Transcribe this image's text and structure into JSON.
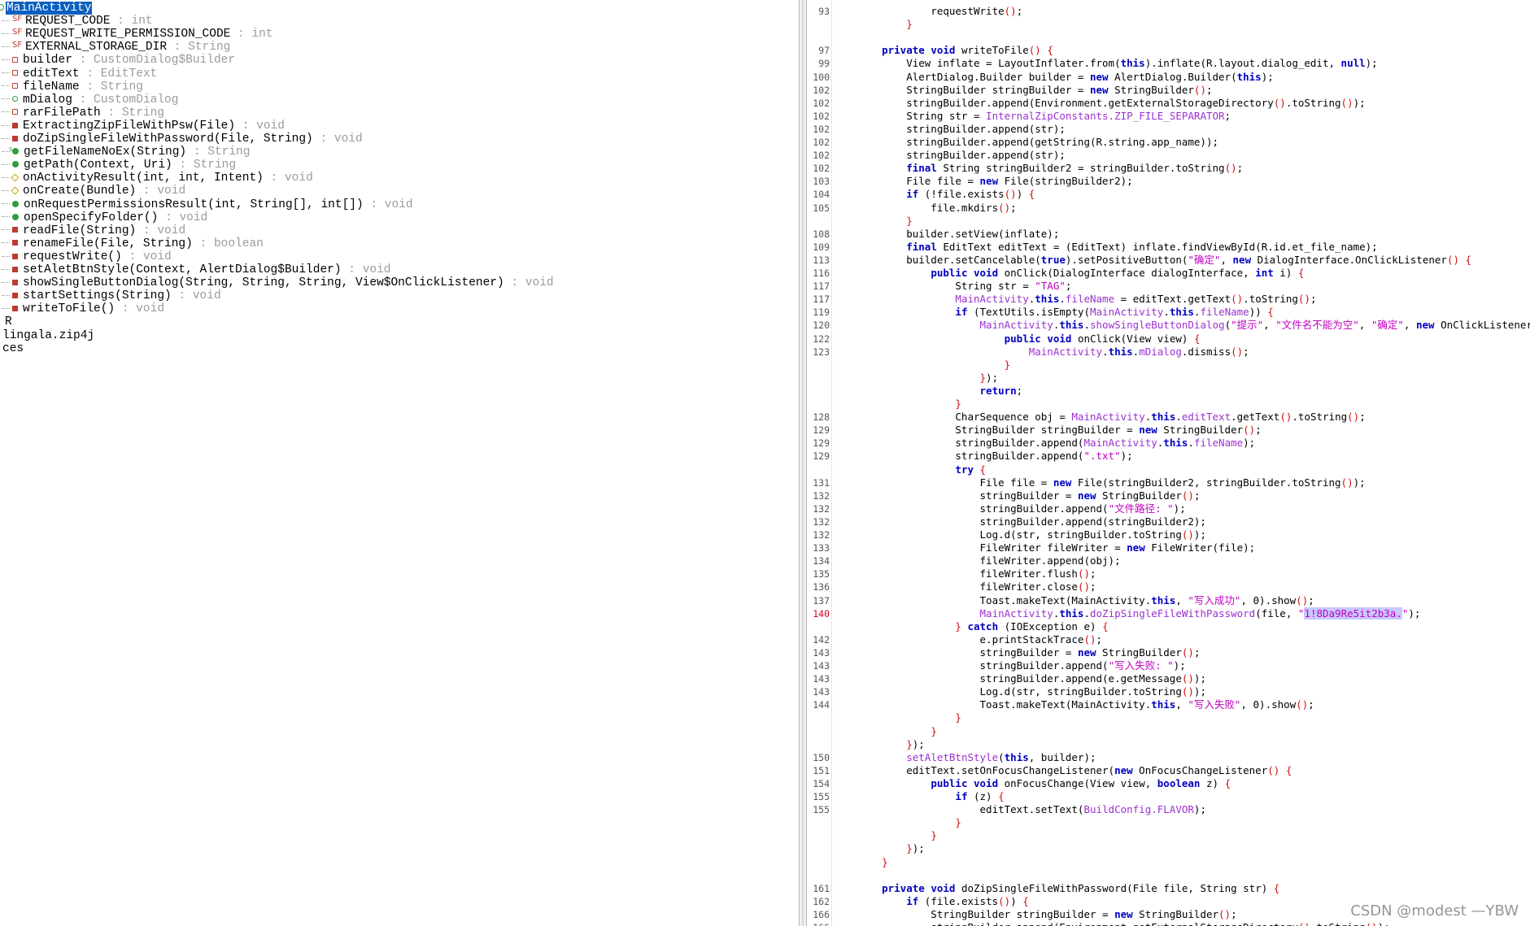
{
  "outline": {
    "root": "MainActivity",
    "members": [
      {
        "icon": "field-static",
        "name": "REQUEST_CODE",
        "type": "int"
      },
      {
        "icon": "field-static",
        "name": "REQUEST_WRITE_PERMISSION_CODE",
        "type": "int"
      },
      {
        "icon": "field-static",
        "name": "EXTERNAL_STORAGE_DIR",
        "type": "String"
      },
      {
        "icon": "field-private",
        "name": "builder",
        "type": "CustomDialog$Builder"
      },
      {
        "icon": "field-private",
        "name": "editText",
        "type": "EditText"
      },
      {
        "icon": "field-private",
        "name": "fileName",
        "type": "String"
      },
      {
        "icon": "method-public-hollow",
        "name": "mDialog",
        "type": "CustomDialog"
      },
      {
        "icon": "field-private",
        "name": "rarFilePath",
        "type": "String"
      },
      {
        "icon": "method-private",
        "name": "ExtractingZipFileWithPsw(File)",
        "type": "void"
      },
      {
        "icon": "method-private",
        "name": "doZipSingleFileWithPassword(File, String)",
        "type": "void"
      },
      {
        "icon": "method-static",
        "name": "getFileNameNoEx(String)",
        "type": "String"
      },
      {
        "icon": "method-public",
        "name": "getPath(Context, Uri)",
        "type": "String"
      },
      {
        "icon": "method-protected",
        "name": "onActivityResult(int, int, Intent)",
        "type": "void"
      },
      {
        "icon": "method-protected",
        "name": "onCreate(Bundle)",
        "type": "void"
      },
      {
        "icon": "method-public",
        "name": "onRequestPermissionsResult(int, String[], int[])",
        "type": "void"
      },
      {
        "icon": "method-public",
        "name": "openSpecifyFolder()",
        "type": "void"
      },
      {
        "icon": "method-private",
        "name": "readFile(String)",
        "type": "void"
      },
      {
        "icon": "method-private",
        "name": "renameFile(File, String)",
        "type": "boolean"
      },
      {
        "icon": "method-private",
        "name": "requestWrite()",
        "type": "void"
      },
      {
        "icon": "method-private",
        "name": "setAletBtnStyle(Context, AlertDialog$Builder)",
        "type": "void"
      },
      {
        "icon": "method-private",
        "name": "showSingleButtonDialog(String, String, String, View$OnClickListener)",
        "type": "void"
      },
      {
        "icon": "method-private",
        "name": "startSettings(String)",
        "type": "void"
      },
      {
        "icon": "method-private",
        "name": "writeToFile()",
        "type": "void"
      }
    ],
    "after": [
      "R",
      "lingala.zip4j",
      "ces"
    ]
  },
  "code": [
    {
      "n": "93",
      "t": "            requestWrite();"
    },
    {
      "n": "",
      "t": "        }"
    },
    {
      "n": "",
      "t": ""
    },
    {
      "n": "97",
      "t": "    private void writeToFile() {"
    },
    {
      "n": "99",
      "t": "        View inflate = LayoutInflater.from(this).inflate(R.layout.dialog_edit, null);"
    },
    {
      "n": "100",
      "t": "        AlertDialog.Builder builder = new AlertDialog.Builder(this);"
    },
    {
      "n": "102",
      "t": "        StringBuilder stringBuilder = new StringBuilder();"
    },
    {
      "n": "102",
      "t": "        stringBuilder.append(Environment.getExternalStorageDirectory().toString());"
    },
    {
      "n": "102",
      "t": "        String str = InternalZipConstants.ZIP_FILE_SEPARATOR;"
    },
    {
      "n": "102",
      "t": "        stringBuilder.append(str);"
    },
    {
      "n": "102",
      "t": "        stringBuilder.append(getString(R.string.app_name));"
    },
    {
      "n": "102",
      "t": "        stringBuilder.append(str);"
    },
    {
      "n": "102",
      "t": "        final String stringBuilder2 = stringBuilder.toString();"
    },
    {
      "n": "103",
      "t": "        File file = new File(stringBuilder2);"
    },
    {
      "n": "104",
      "t": "        if (!file.exists()) {"
    },
    {
      "n": "105",
      "t": "            file.mkdirs();"
    },
    {
      "n": "",
      "t": "        }"
    },
    {
      "n": "108",
      "t": "        builder.setView(inflate);"
    },
    {
      "n": "109",
      "t": "        final EditText editText = (EditText) inflate.findViewById(R.id.et_file_name);"
    },
    {
      "n": "113",
      "t": "        builder.setCancelable(true).setPositiveButton(\"确定\", new DialogInterface.OnClickListener() {"
    },
    {
      "n": "116",
      "t": "            public void onClick(DialogInterface dialogInterface, int i) {"
    },
    {
      "n": "117",
      "t": "                String str = \"TAG\";"
    },
    {
      "n": "117",
      "t": "                MainActivity.this.fileName = editText.getText().toString();"
    },
    {
      "n": "119",
      "t": "                if (TextUtils.isEmpty(MainActivity.this.fileName)) {"
    },
    {
      "n": "120",
      "t": "                    MainActivity.this.showSingleButtonDialog(\"提示\", \"文件名不能为空\", \"确定\", new OnClickListener() {"
    },
    {
      "n": "122",
      "t": "                        public void onClick(View view) {"
    },
    {
      "n": "123",
      "t": "                            MainActivity.this.mDialog.dismiss();"
    },
    {
      "n": "",
      "t": "                        }"
    },
    {
      "n": "",
      "t": "                    });"
    },
    {
      "n": "",
      "t": "                    return;"
    },
    {
      "n": "",
      "t": "                }"
    },
    {
      "n": "128",
      "t": "                CharSequence obj = MainActivity.this.editText.getText().toString();"
    },
    {
      "n": "129",
      "t": "                StringBuilder stringBuilder = new StringBuilder();"
    },
    {
      "n": "129",
      "t": "                stringBuilder.append(MainActivity.this.fileName);"
    },
    {
      "n": "129",
      "t": "                stringBuilder.append(\".txt\");"
    },
    {
      "n": "",
      "t": "                try {"
    },
    {
      "n": "131",
      "t": "                    File file = new File(stringBuilder2, stringBuilder.toString());"
    },
    {
      "n": "132",
      "t": "                    stringBuilder = new StringBuilder();"
    },
    {
      "n": "132",
      "t": "                    stringBuilder.append(\"文件路径: \");"
    },
    {
      "n": "132",
      "t": "                    stringBuilder.append(stringBuilder2);"
    },
    {
      "n": "132",
      "t": "                    Log.d(str, stringBuilder.toString());"
    },
    {
      "n": "133",
      "t": "                    FileWriter fileWriter = new FileWriter(file);"
    },
    {
      "n": "134",
      "t": "                    fileWriter.append(obj);"
    },
    {
      "n": "135",
      "t": "                    fileWriter.flush();"
    },
    {
      "n": "136",
      "t": "                    fileWriter.close();"
    },
    {
      "n": "137",
      "t": "                    Toast.makeText(MainActivity.this, \"写入成功\", 0).show();"
    },
    {
      "n": "140",
      "t": "                    MainActivity.this.doZipSingleFileWithPassword(file, \"1!8Da9Re5it2b3a.\");",
      "err": true
    },
    {
      "n": "",
      "t": "                } catch (IOException e) {"
    },
    {
      "n": "142",
      "t": "                    e.printStackTrace();"
    },
    {
      "n": "143",
      "t": "                    stringBuilder = new StringBuilder();"
    },
    {
      "n": "143",
      "t": "                    stringBuilder.append(\"写入失败: \");"
    },
    {
      "n": "143",
      "t": "                    stringBuilder.append(e.getMessage());"
    },
    {
      "n": "143",
      "t": "                    Log.d(str, stringBuilder.toString());"
    },
    {
      "n": "144",
      "t": "                    Toast.makeText(MainActivity.this, \"写入失败\", 0).show();"
    },
    {
      "n": "",
      "t": "                }"
    },
    {
      "n": "",
      "t": "            }"
    },
    {
      "n": "",
      "t": "        });"
    },
    {
      "n": "150",
      "t": "        setAletBtnStyle(this, builder);"
    },
    {
      "n": "151",
      "t": "        editText.setOnFocusChangeListener(new OnFocusChangeListener() {"
    },
    {
      "n": "154",
      "t": "            public void onFocusChange(View view, boolean z) {"
    },
    {
      "n": "155",
      "t": "                if (z) {"
    },
    {
      "n": "155",
      "t": "                    editText.setText(BuildConfig.FLAVOR);"
    },
    {
      "n": "",
      "t": "                }"
    },
    {
      "n": "",
      "t": "            }"
    },
    {
      "n": "",
      "t": "        });"
    },
    {
      "n": "",
      "t": "    }"
    },
    {
      "n": "",
      "t": ""
    },
    {
      "n": "161",
      "t": "    private void doZipSingleFileWithPassword(File file, String str) {"
    },
    {
      "n": "162",
      "t": "        if (file.exists()) {"
    },
    {
      "n": "166",
      "t": "            StringBuilder stringBuilder = new StringBuilder();"
    },
    {
      "n": "166",
      "t": "            stringBuilder.append(Environment.getExternalStorageDirectory().toString());"
    }
  ],
  "highlight_token": "1!8Da9Re5it2b3a.",
  "watermark": "CSDN @modest —YBW"
}
